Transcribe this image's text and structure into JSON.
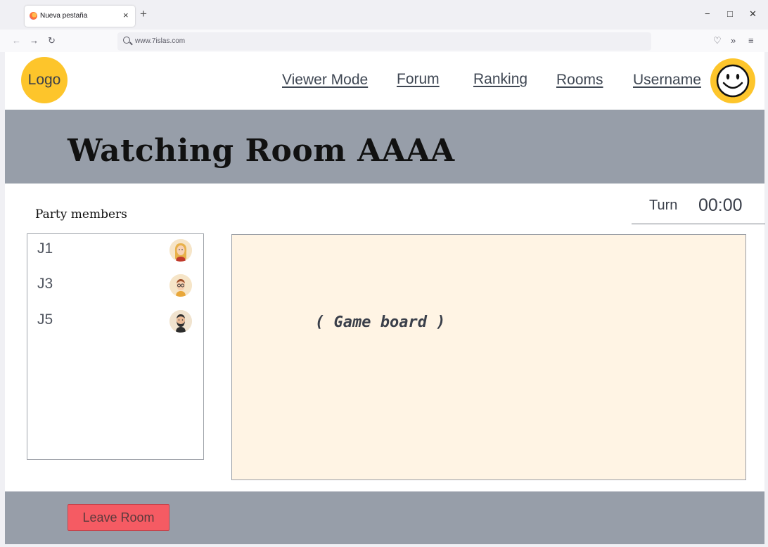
{
  "browser": {
    "tab_title": "Nueva pestaña",
    "url": "www.7islas.com"
  },
  "header": {
    "logo_text": "Logo",
    "nav": [
      "Viewer Mode",
      "Forum",
      "Ranking",
      "Rooms",
      "Username"
    ]
  },
  "room": {
    "title": "Watching Room AAAA",
    "party_label": "Party members",
    "turn_label": "Turn",
    "timer": "00:00",
    "members": [
      {
        "name": "J1",
        "avatar": "woman-blonde-avatar"
      },
      {
        "name": "J3",
        "avatar": "man-glasses-avatar"
      },
      {
        "name": "J5",
        "avatar": "man-beard-avatar"
      }
    ],
    "board_label": "( Game board )",
    "leave_label": "Leave Room"
  },
  "colors": {
    "accent_yellow": "#fdc52b",
    "band_gray": "#979ea9",
    "board_bg": "#fff4e4",
    "leave_red": "#f55b63"
  }
}
